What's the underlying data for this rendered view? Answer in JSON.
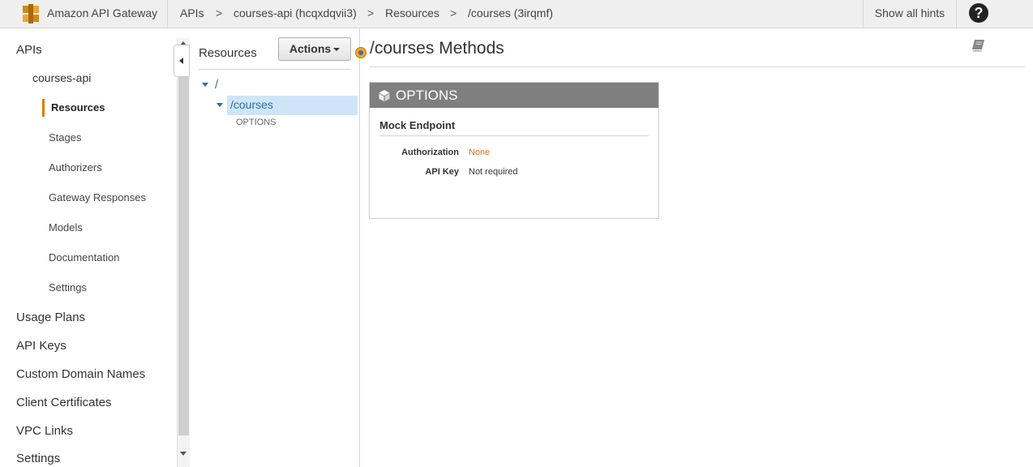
{
  "topbar": {
    "brand": "Amazon API Gateway",
    "breadcrumbs": [
      "APIs",
      "courses-api (hcqxdqvii3)",
      "Resources",
      "/courses (3irqmf)"
    ],
    "separator": ">",
    "show_hints": "Show all hints",
    "help": "?"
  },
  "nav": {
    "apis": "APIs",
    "api_name": "courses-api",
    "api_items": [
      "Resources",
      "Stages",
      "Authorizers",
      "Gateway Responses",
      "Models",
      "Documentation",
      "Settings"
    ],
    "active_item": "Resources",
    "top_items": [
      "Usage Plans",
      "API Keys",
      "Custom Domain Names",
      "Client Certificates",
      "VPC Links",
      "Settings"
    ]
  },
  "resources": {
    "title": "Resources",
    "actions_label": "Actions",
    "tree": {
      "root": "/",
      "selected": "/courses",
      "method": "OPTIONS"
    }
  },
  "main": {
    "title": "/courses Methods",
    "method_card": {
      "method": "OPTIONS",
      "integration": "Mock Endpoint",
      "rows": [
        {
          "label": "Authorization",
          "value": "None",
          "highlight": true
        },
        {
          "label": "API Key",
          "value": "Not required",
          "highlight": false
        }
      ]
    }
  },
  "colors": {
    "accent": "#e07b00",
    "link": "#2c6ea8",
    "selected_bg": "#cfe5f7",
    "card_header": "#7f7f7f",
    "auth_value": "#d4761c"
  }
}
